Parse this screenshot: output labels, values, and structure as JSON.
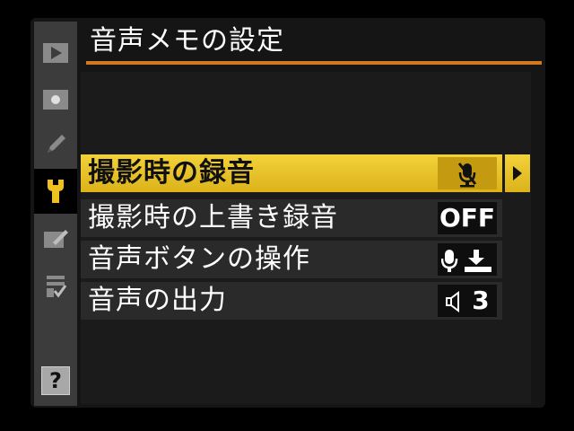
{
  "screen": {
    "title": "音声メモの設定"
  },
  "tabs": [
    {
      "icon": "playback-icon",
      "active": false
    },
    {
      "icon": "shooting-icon",
      "active": false
    },
    {
      "icon": "custom-settings-pencil-icon",
      "active": false
    },
    {
      "icon": "setup-wrench-icon",
      "active": true
    },
    {
      "icon": "retouch-icon",
      "active": false
    },
    {
      "icon": "my-menu-icon",
      "active": false
    }
  ],
  "help": {
    "label": "?"
  },
  "menu": {
    "items": [
      {
        "label": "撮影時の録音",
        "value_icon": "mic-off-icon",
        "selected": true
      },
      {
        "label": "撮影時の上書き録音",
        "value": "OFF",
        "selected": false
      },
      {
        "label": "音声ボタンの操作",
        "value_icon": "mic-press-icon",
        "selected": false
      },
      {
        "label": "音声の出力",
        "value": "3",
        "value_icon": "speaker-icon",
        "selected": false
      }
    ]
  },
  "colors": {
    "highlight": "#e8c62a",
    "title_rule": "#d2781e",
    "rail": "#3c3c3c"
  }
}
